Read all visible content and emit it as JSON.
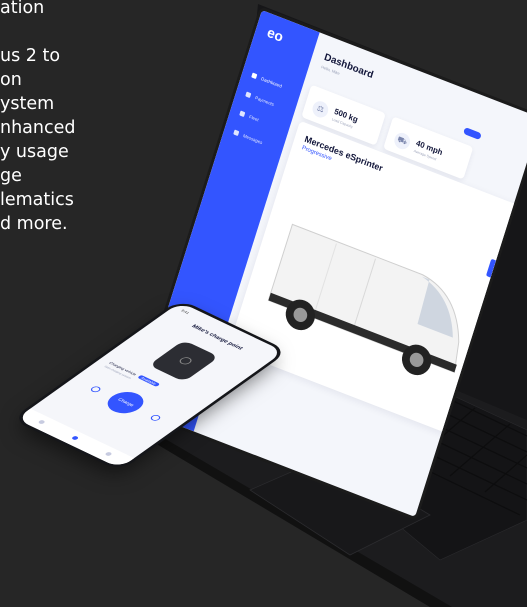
{
  "feature_text": {
    "lines": [
      "ation",
      "us 2 to",
      "on",
      "ystem",
      "nhanced",
      "y usage",
      "ge",
      "lematics",
      "d more."
    ]
  },
  "laptop": {
    "logo": "eo",
    "nav": [
      {
        "label": "Dashboard",
        "active": true
      },
      {
        "label": "Payments",
        "active": false
      },
      {
        "label": "Fleet",
        "active": false
      },
      {
        "label": "Messages",
        "active": false
      }
    ],
    "title": "Dashboard",
    "subtitle": "Hello, Mike",
    "cards": [
      {
        "value": "500 kg",
        "label": "Load Capacity",
        "icon": "weight-icon"
      },
      {
        "value": "40 mph",
        "label": "Average Speed",
        "icon": "van-icon"
      }
    ],
    "vehicle": {
      "name": "Mercedes eSprinter",
      "plan": "Progressive"
    }
  },
  "phone": {
    "time": "9:41",
    "title": "Mike's charge point",
    "status_text": "Charging vehicle",
    "status_pill": "Available",
    "sub_text": "Start charging session",
    "button_label": "Charge"
  },
  "colors": {
    "background": "#262626",
    "accent": "#3355ff",
    "text": "#ffffff"
  }
}
